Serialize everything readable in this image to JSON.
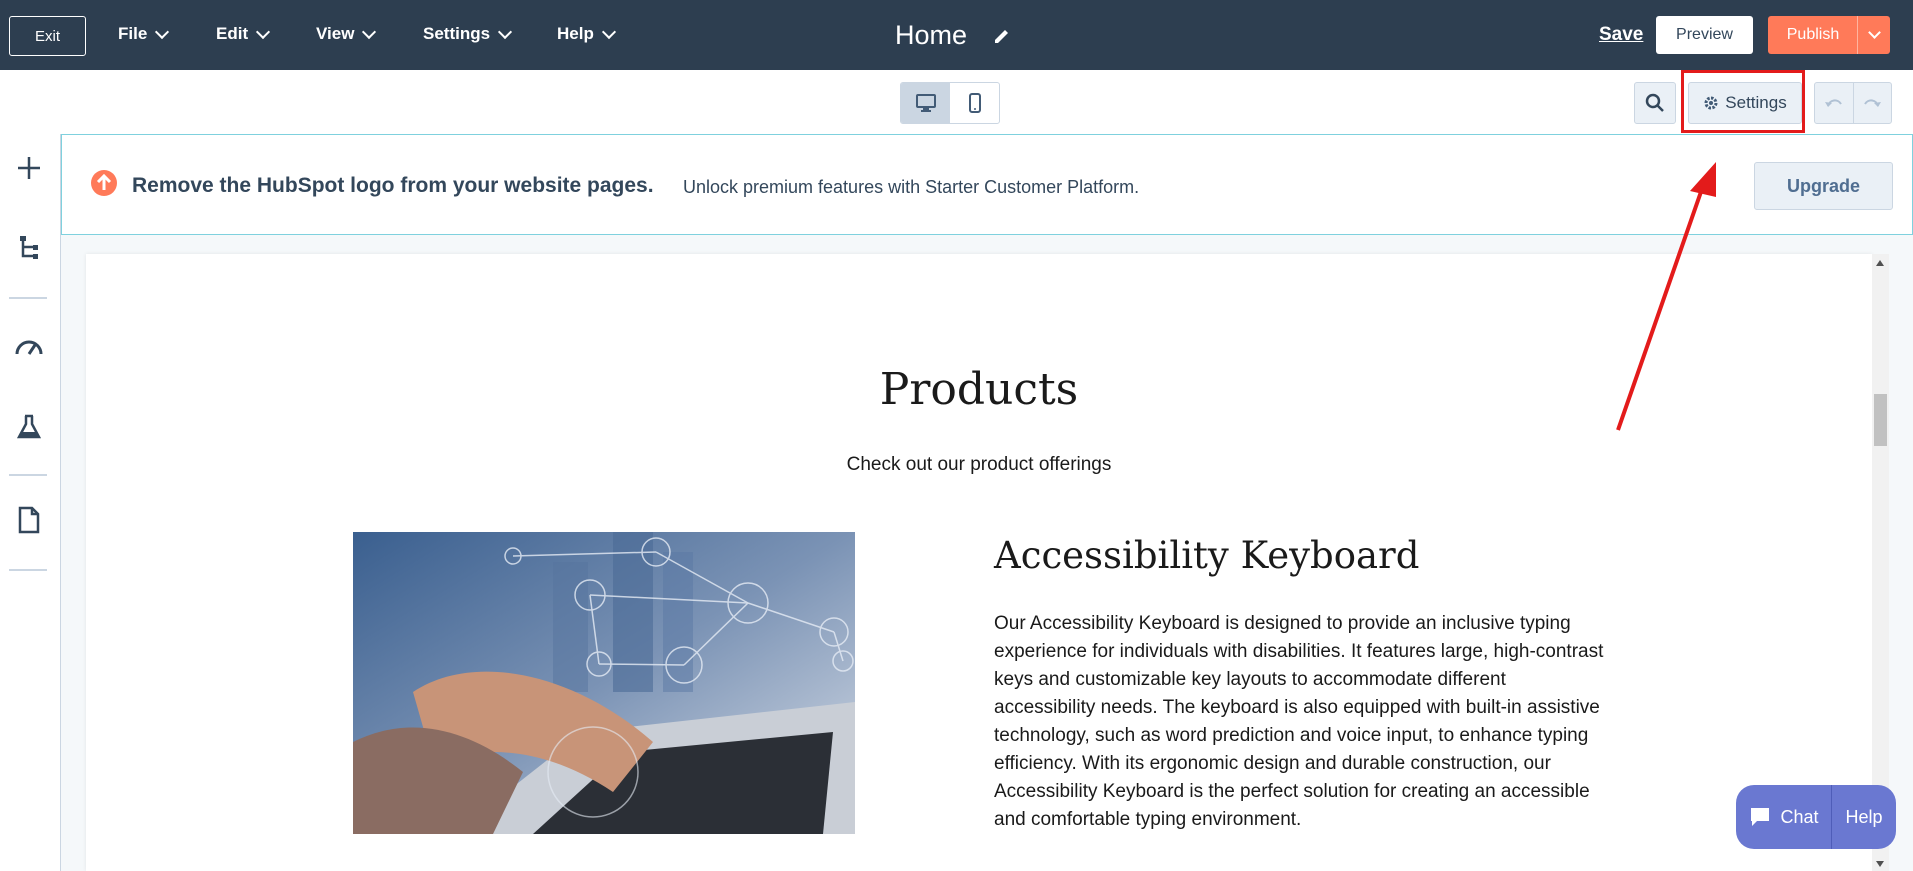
{
  "topbar": {
    "exit_label": "Exit",
    "menus": [
      "File",
      "Edit",
      "View",
      "Settings",
      "Help"
    ],
    "page_title": "Home",
    "save_label": "Save",
    "preview_label": "Preview",
    "publish_label": "Publish"
  },
  "toolbar": {
    "settings_label": "Settings"
  },
  "banner": {
    "title": "Remove the HubSpot logo from your website pages.",
    "description": "Unlock premium features with Starter Customer Platform.",
    "upgrade_label": "Upgrade"
  },
  "content": {
    "heading": "Products",
    "subheading": "Check out our product offerings",
    "product": {
      "title": "Accessibility Keyboard",
      "description": "Our Accessibility Keyboard is designed to provide an inclusive typing experience for individuals with disabilities. It features large, high-contrast keys and customizable key layouts to accommodate different accessibility needs. The keyboard is also equipped with built-in assistive technology, such as word prediction and voice input, to enhance typing efficiency. With its ergonomic design and durable construction, our Accessibility Keyboard is the perfect solution for creating an accessible and comfortable typing environment."
    }
  },
  "chat_widget": {
    "chat_label": "Chat",
    "help_label": "Help"
  },
  "colors": {
    "topbar_bg": "#2d3e50",
    "publish_bg": "#ff7a59",
    "annotation_red": "#e31b1b",
    "chat_bg": "#6a78d1"
  },
  "icons": {
    "sidebar": [
      "plus-icon",
      "tree-icon",
      "gauge-icon",
      "flask-icon",
      "document-icon"
    ]
  }
}
